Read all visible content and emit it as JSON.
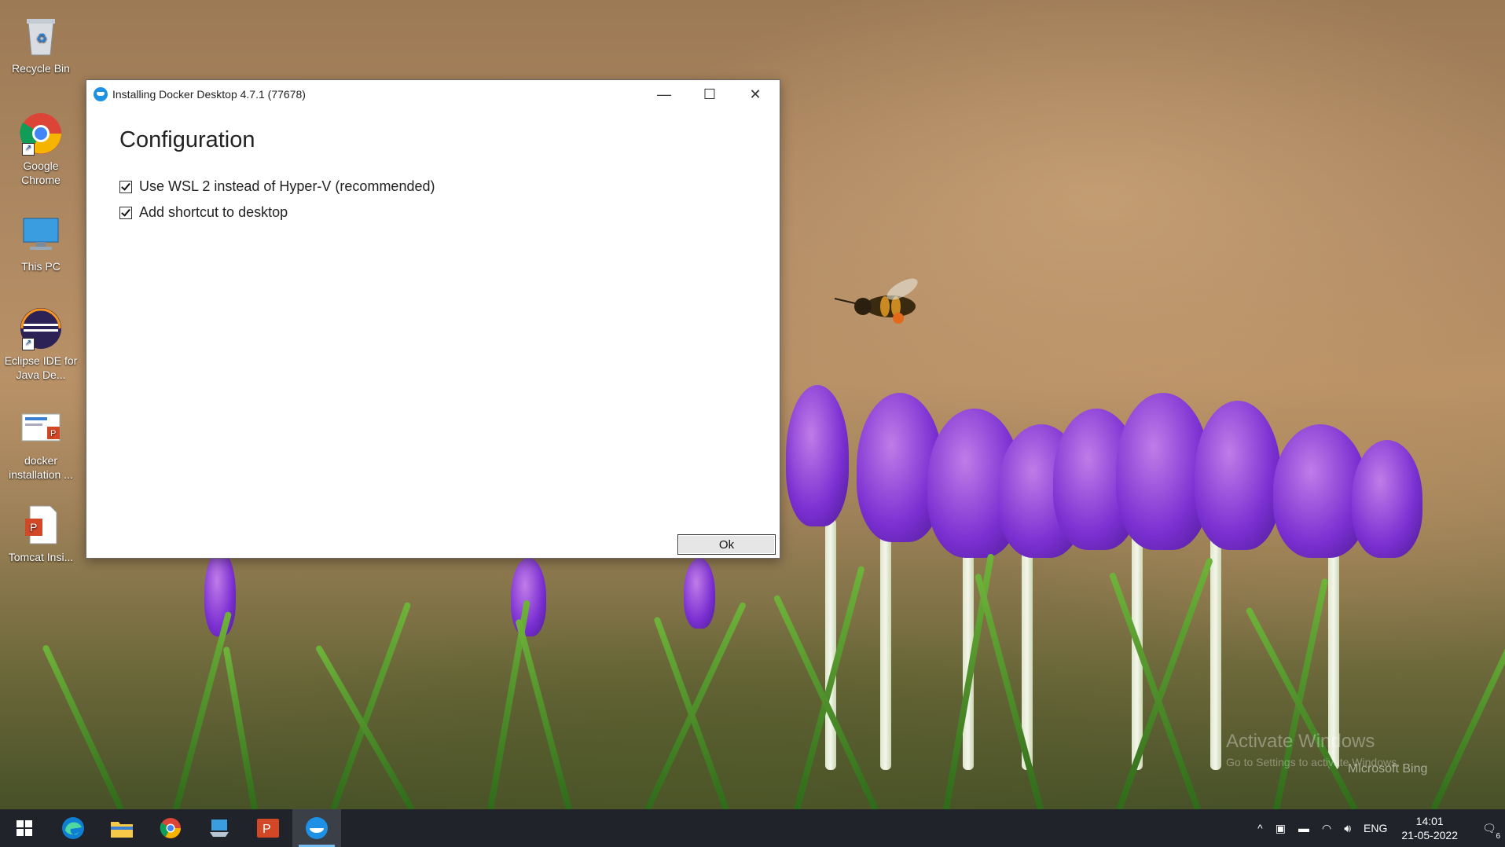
{
  "desktop": {
    "icons": [
      {
        "label": "Recycle Bin"
      },
      {
        "label": "Google Chrome"
      },
      {
        "label": "This PC"
      },
      {
        "label": "Eclipse IDE for Java De..."
      },
      {
        "label": "docker installation ..."
      },
      {
        "label": "Tomcat Insi..."
      }
    ],
    "watermark": {
      "line1": "Activate Windows",
      "line2": "Go to Settings to activate Windows."
    },
    "bing_label": "Microsoft Bing"
  },
  "window": {
    "title": "Installing Docker Desktop 4.7.1 (77678)",
    "controls": {
      "minimize": "—",
      "maximize": "☐",
      "close": "✕"
    },
    "heading": "Configuration",
    "options": [
      {
        "label": "Use WSL 2 instead of Hyper-V (recommended)",
        "checked": true
      },
      {
        "label": "Add shortcut to desktop",
        "checked": true
      }
    ],
    "ok_label": "Ok"
  },
  "taskbar": {
    "apps": [
      "start-icon",
      "edge-icon",
      "file-explorer-icon",
      "chrome-icon",
      "remote-desktop-icon",
      "powerpoint-icon",
      "docker-icon"
    ],
    "tray": {
      "language": "ENG",
      "time": "14:01",
      "date": "21-05-2022",
      "notification_count": "6"
    }
  }
}
